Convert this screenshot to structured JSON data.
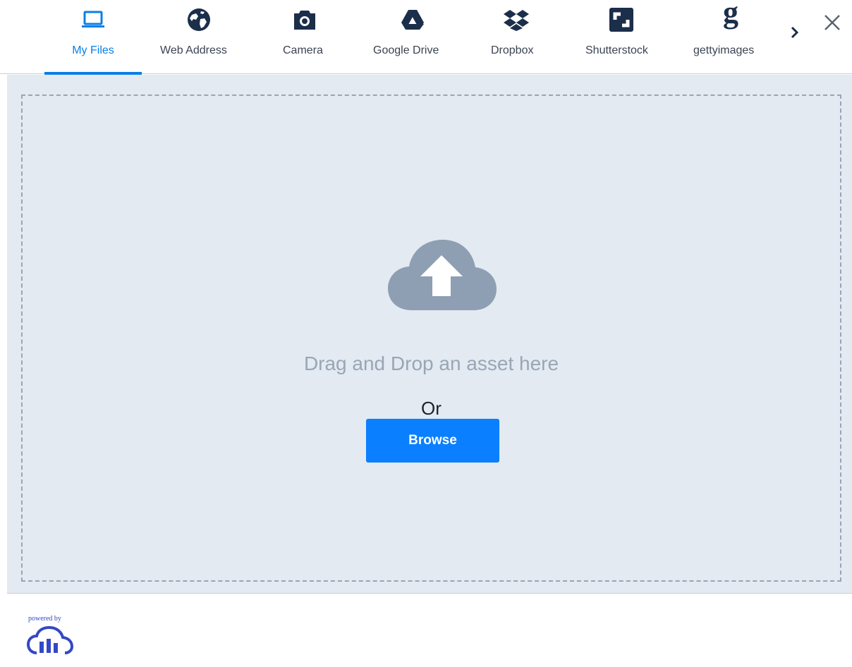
{
  "tabs": [
    {
      "label": "My Files",
      "icon": "laptop-icon",
      "active": true
    },
    {
      "label": "Web Address",
      "icon": "globe-icon",
      "active": false
    },
    {
      "label": "Camera",
      "icon": "camera-icon",
      "active": false
    },
    {
      "label": "Google Drive",
      "icon": "google-drive-icon",
      "active": false
    },
    {
      "label": "Dropbox",
      "icon": "dropbox-icon",
      "active": false
    },
    {
      "label": "Shutterstock",
      "icon": "shutterstock-icon",
      "active": false
    },
    {
      "label": "gettyimages",
      "icon": "gettyimages-icon",
      "active": false
    }
  ],
  "toolbar": {
    "more_icon": "chevron-right-icon",
    "close_icon": "close-icon"
  },
  "dropzone": {
    "icon": "cloud-upload-icon",
    "instruction": "Drag and Drop an asset here",
    "or_text": "Or",
    "browse_label": "Browse"
  },
  "footer": {
    "powered_text": "powered by",
    "logo": "cloudinary-logo-icon"
  },
  "colors": {
    "accent": "#0a7fe6",
    "button": "#0a7fff",
    "icon_dark": "#1b2e4a",
    "drop_background": "#e3eaf1",
    "dashed_border": "#98a5b6",
    "cloud_icon": "#8e9fb3",
    "logo": "#3448c5"
  }
}
